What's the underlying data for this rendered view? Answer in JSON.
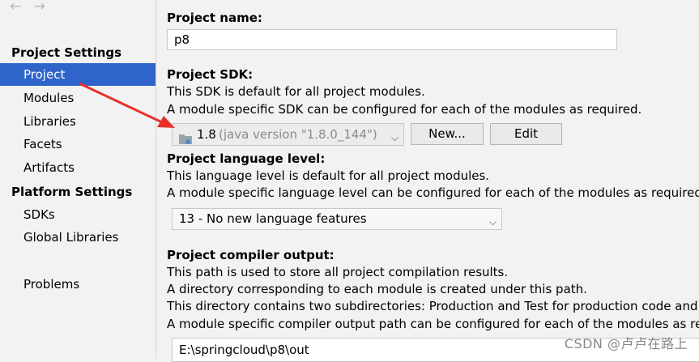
{
  "nav": {
    "back": "←",
    "forward": "→"
  },
  "sidebar": {
    "project_settings_title": "Project Settings",
    "platform_settings_title": "Platform Settings",
    "items": [
      {
        "label": "Project"
      },
      {
        "label": "Modules"
      },
      {
        "label": "Libraries"
      },
      {
        "label": "Facets"
      },
      {
        "label": "Artifacts"
      }
    ],
    "platform_items": [
      {
        "label": "SDKs"
      },
      {
        "label": "Global Libraries"
      }
    ],
    "problems": "Problems"
  },
  "main": {
    "project_name_label": "Project name:",
    "project_name_value": "p8",
    "sdk_label": "Project SDK:",
    "sdk_desc1": "This SDK is default for all project modules.",
    "sdk_desc2": "A module specific SDK can be configured for each of the modules as required.",
    "sdk_value": "1.8",
    "sdk_version": "(java version \"1.8.0_144\")",
    "new_button": "New...",
    "edit_button": "Edit",
    "lang_label": "Project language level:",
    "lang_desc1": "This language level is default for all project modules.",
    "lang_desc2": "A module specific language level can be configured for each of the modules as required.",
    "lang_value": "13 - No new language features",
    "output_label": "Project compiler output:",
    "output_desc1": "This path is used to store all project compilation results.",
    "output_desc2": "A directory corresponding to each module is created under this path.",
    "output_desc3": "This directory contains two subdirectories: Production and Test for production code and te",
    "output_desc4": "A module specific compiler output path can be configured for each of the modules as requ",
    "output_value": "E:\\springcloud\\p8\\out"
  },
  "watermark": "CSDN @卢卢在路上",
  "colors": {
    "selection": "#2f65ca",
    "annotation_arrow": "#e8312b"
  }
}
